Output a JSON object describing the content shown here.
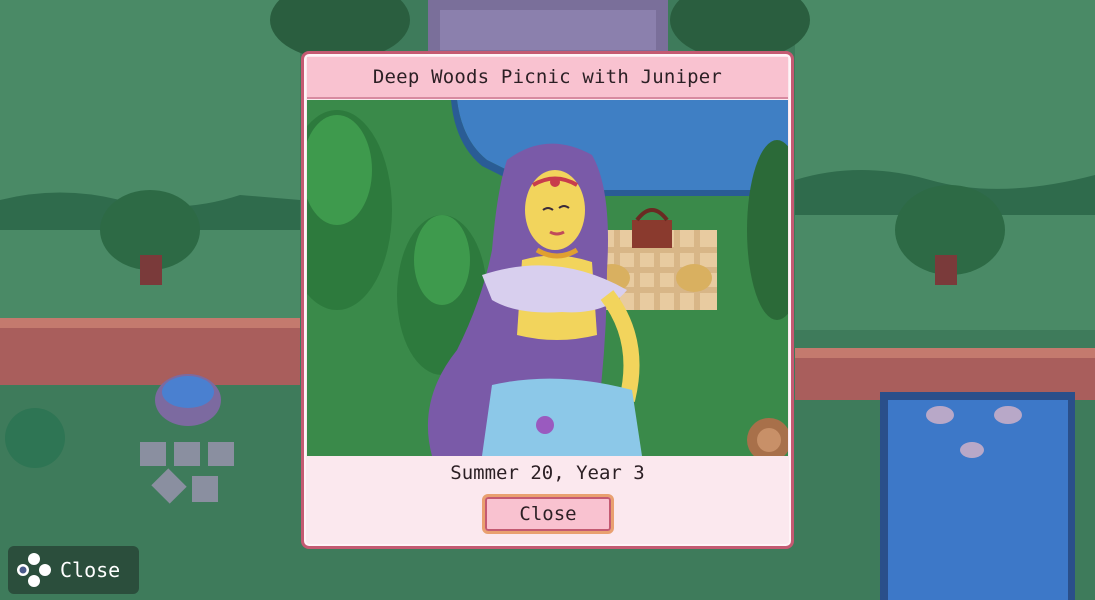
{
  "dialog": {
    "title": "Deep Woods Picnic with Juniper",
    "date": "Summer 20, Year 3",
    "close_label": "Close"
  },
  "hint": {
    "icon": "dpad-icon",
    "label": "Close"
  },
  "colors": {
    "dialog_bg": "#fbe8ee",
    "header_bg": "#f9c2d0",
    "dialog_border": "#c45a72",
    "button_border": "#e9a070",
    "forest": "#3f7a5a",
    "water": "#3d78c8"
  }
}
